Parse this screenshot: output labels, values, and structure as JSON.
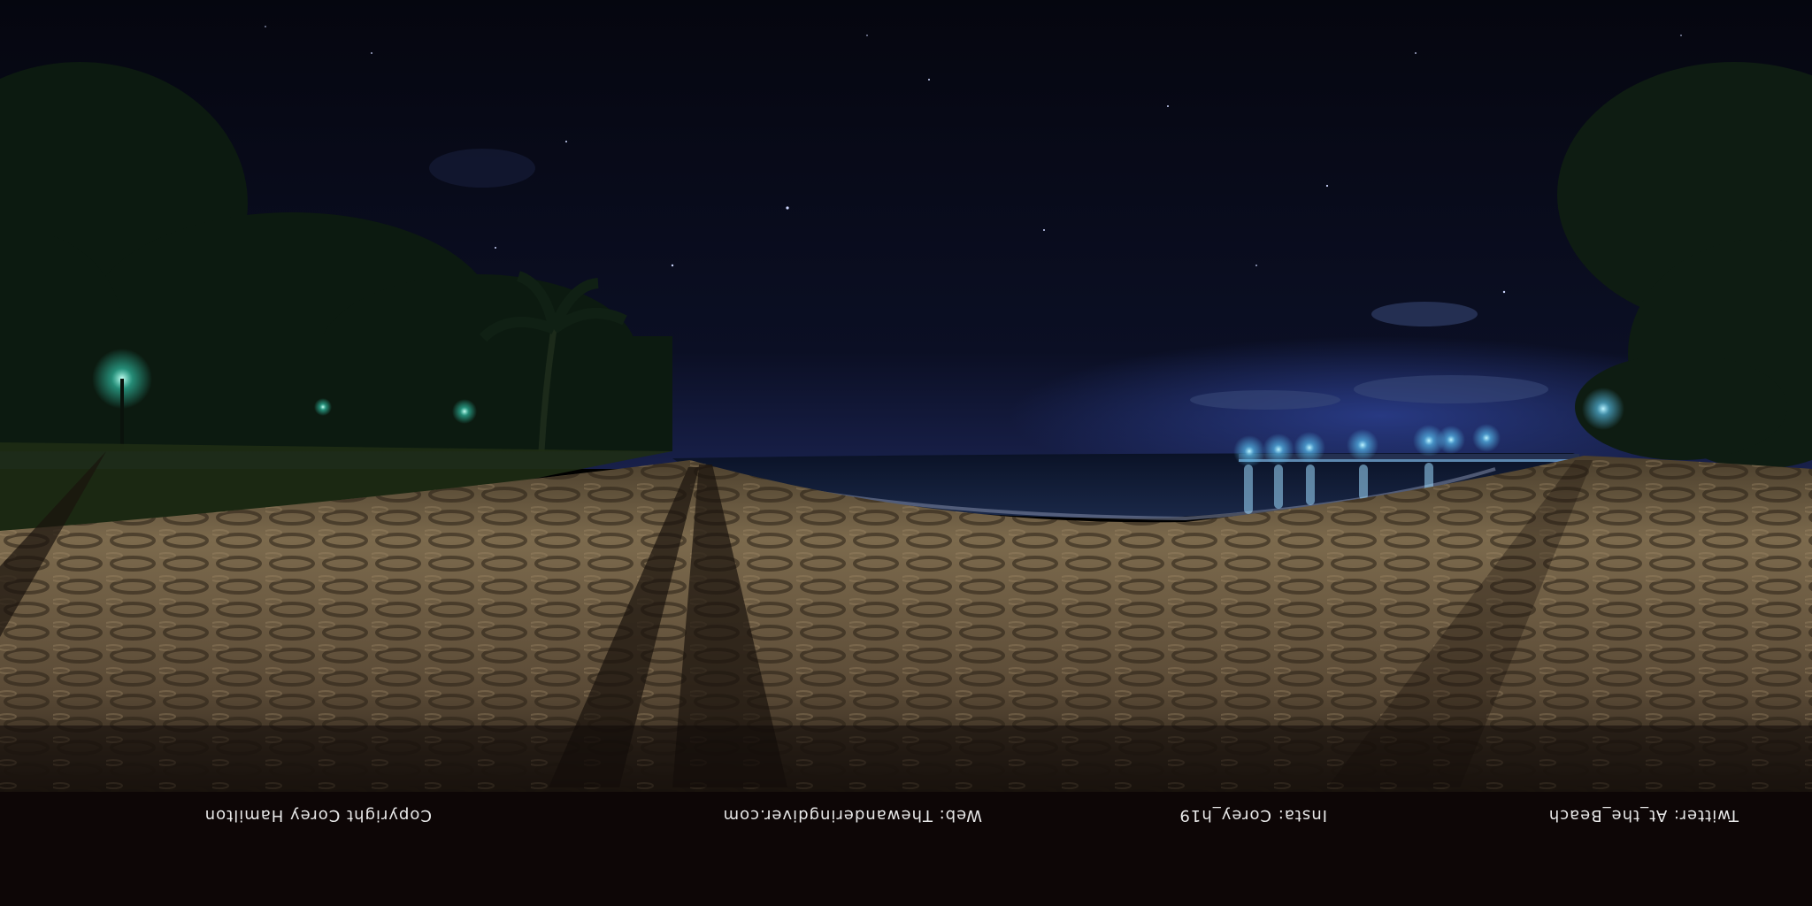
{
  "scene": {
    "subject_icon": "panorama-icon",
    "colors": {
      "sky_top": "#05060f",
      "sky_horizon": "#141a3a",
      "sand_light": "#8a7658",
      "sand_dark": "#2a2218",
      "water": "#0c1428",
      "pier_light": "#8fd3ff",
      "lamp_green": "#39e6c8",
      "trees": "#0e1e12",
      "floor": "#0d0606"
    }
  },
  "credits": {
    "copyright": "Copyright Corey Hamilton",
    "web": "Web: Thewanderingdiver.com",
    "insta": "Insta: Corey_h19",
    "twitter": "Twitter: At_the_Beach"
  }
}
